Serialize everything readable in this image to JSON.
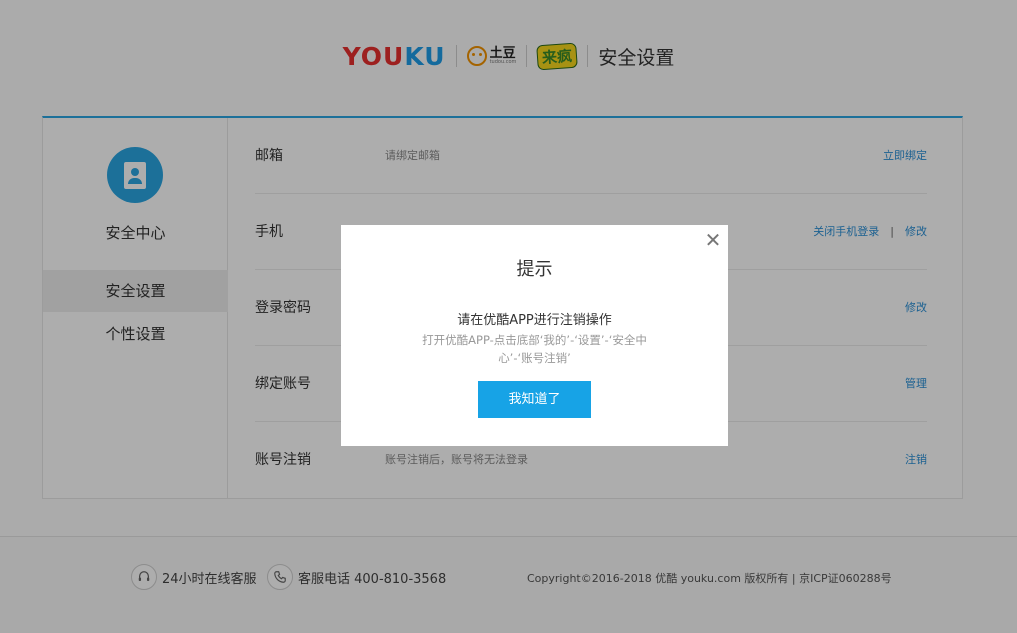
{
  "header": {
    "brand_youku_left": "YOU",
    "brand_youku_right": "KU",
    "brand_tudou": "土豆",
    "brand_tudou_sub": "tudou.com",
    "brand_laifeng": "来疯",
    "title": "安全设置"
  },
  "sidebar": {
    "avatar_icon": "security-document-icon",
    "title": "安全中心",
    "items": [
      {
        "label": "安全设置",
        "active": true
      },
      {
        "label": "个性设置",
        "active": false
      }
    ]
  },
  "rows": [
    {
      "label": "邮箱",
      "desc": "请绑定邮箱",
      "actions": [
        "立即绑定"
      ]
    },
    {
      "label": "手机",
      "desc": "",
      "actions": [
        "关闭手机登录",
        "修改"
      ]
    },
    {
      "label": "登录密码",
      "desc": "",
      "actions": [
        "修改"
      ]
    },
    {
      "label": "绑定账号",
      "desc": "",
      "actions": [
        "管理"
      ]
    },
    {
      "label": "账号注销",
      "desc": "账号注销后，账号将无法登录",
      "actions": [
        "注销"
      ]
    }
  ],
  "actions_separator": "|",
  "footer": {
    "service_online": "24小时在线客服",
    "service_phone": "客服电话 400-810-3568",
    "copyright": "Copyright©2016-2018 优酷 youku.com 版权所有 | 京ICP证060288号"
  },
  "modal": {
    "close_icon": "close-icon",
    "title": "提示",
    "message": "请在优酷APP进行注销操作",
    "sub_line1": "打开优酷APP-点击底部‘我的’-‘设置’-‘安全中",
    "sub_line2": "心’-‘账号注销’",
    "confirm_label": "我知道了"
  },
  "colors": {
    "accent": "#17a3e6",
    "link": "#2a8fd6",
    "youku_red": "#e8302f",
    "youku_blue": "#1e9ce8"
  }
}
